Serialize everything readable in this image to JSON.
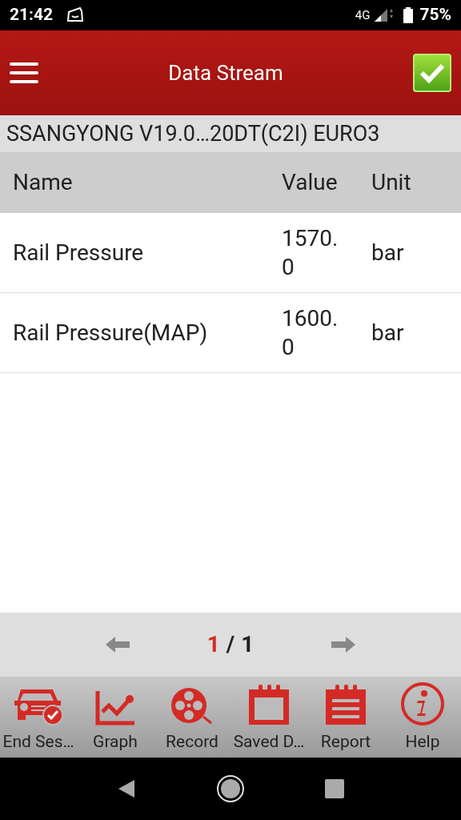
{
  "status_bar": {
    "time": "21:42",
    "network": "4G",
    "battery": "75%"
  },
  "header": {
    "title": "Data Stream"
  },
  "vehicle": {
    "title": "SSANGYONG V19.0…20DT(C2I) EURO3"
  },
  "table": {
    "columns": [
      "Name",
      "Value",
      "Unit"
    ],
    "rows": [
      {
        "name": "Rail Pressure",
        "value": "1570.0",
        "unit": "bar"
      },
      {
        "name": "Rail Pressure(MAP)",
        "value": "1600.0",
        "unit": "bar"
      }
    ]
  },
  "pager": {
    "current": "1",
    "separator": "/",
    "total": "1"
  },
  "toolbar": [
    {
      "kind": "car",
      "label": "End Ses…"
    },
    {
      "kind": "graph",
      "label": "Graph"
    },
    {
      "kind": "record",
      "label": "Record"
    },
    {
      "kind": "calendar",
      "label": "Saved D…"
    },
    {
      "kind": "report",
      "label": "Report"
    },
    {
      "kind": "help",
      "label": "Help"
    }
  ]
}
